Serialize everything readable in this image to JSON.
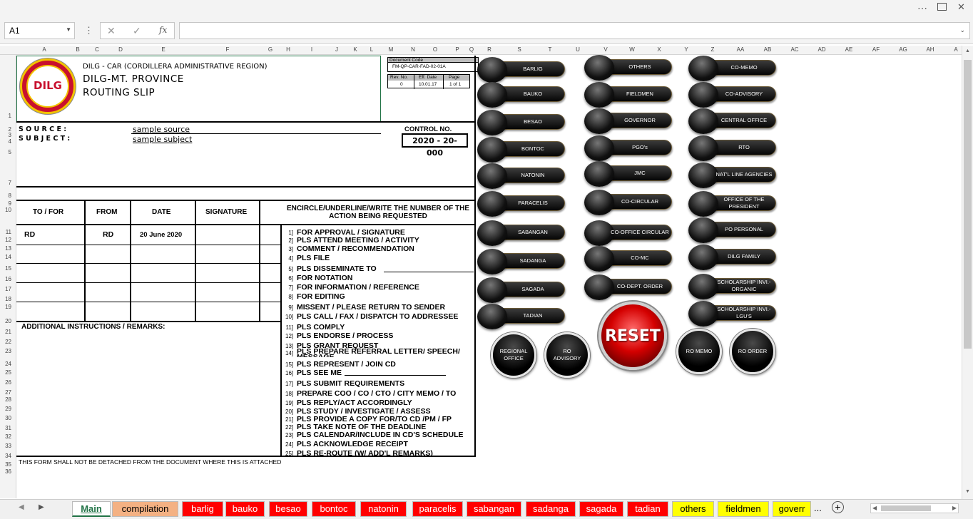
{
  "namebox": {
    "cell": "A1"
  },
  "columns": [
    "A",
    "B",
    "C",
    "D",
    "E",
    "F",
    "G",
    "H",
    "I",
    "J",
    "K",
    "L",
    "M",
    "N",
    "O",
    "P",
    "Q",
    "R",
    "S",
    "T",
    "U",
    "V",
    "W",
    "X",
    "Y",
    "Z",
    "AA",
    "AB",
    "AC",
    "AD",
    "AE",
    "AF",
    "AG",
    "AH",
    "A"
  ],
  "rows": [
    "1",
    "2",
    "3",
    "4",
    "5",
    "7",
    "8",
    "9",
    "10",
    "11",
    "12",
    "13",
    "14",
    "15",
    "16",
    "17",
    "18",
    "19",
    "20",
    "21",
    "22",
    "23",
    "24",
    "25",
    "26",
    "27",
    "28",
    "29",
    "30",
    "31",
    "32",
    "33",
    "34",
    "35",
    "36"
  ],
  "header": {
    "region": "DILG - CAR (CORDILLERA ADMINISTRATIVE REGION)",
    "office": "DILG-MT. PROVINCE",
    "title": "ROUTING SLIP",
    "logo_text": "DILG"
  },
  "doc_code": {
    "label": "Document Code",
    "code": "FM-QP-CAR-FAD-02-01A",
    "rev_label": "Rev. No.",
    "eff_label": "Eff. Date",
    "page_label": "Page",
    "rev": "0",
    "eff": "10.01.17",
    "page": "1 of 1"
  },
  "form": {
    "source_label": "S O U R C E :",
    "subject_label": "S U B J E C T :",
    "source": "sample source",
    "subject": "sample subject",
    "control_label": "CONTROL NO.",
    "control": "2020 - 20- 000",
    "col_to": "TO / FOR",
    "col_from": "FROM",
    "col_date": "DATE",
    "col_sig": "SIGNATURE",
    "col_action": "ENCIRCLE/UNDERLINE/WRITE THE NUMBER OF THE ACTION BEING REQUESTED",
    "row1_to": "RD",
    "row1_from": "RD",
    "row1_date": "20 June 2020",
    "remarks_label": "ADDITIONAL INSTRUCTIONS / REMARKS:",
    "footer": "THIS FORM SHALL NOT BE DETACHED FROM THE DOCUMENT WHERE THIS IS ATTACHED"
  },
  "actions": [
    {
      "n": "1]",
      "t": "FOR APPROVAL / SIGNATURE"
    },
    {
      "n": "2]",
      "t": "PLS ATTEND MEETING / ACTIVITY"
    },
    {
      "n": "3]",
      "t": "COMMENT / RECOMMENDATION"
    },
    {
      "n": "4]",
      "t": "PLS FILE"
    },
    {
      "n": "5]",
      "t": "PLS  DISSEMINATE TO"
    },
    {
      "n": "6]",
      "t": "FOR NOTATION"
    },
    {
      "n": "7]",
      "t": "FOR INFORMATION / REFERENCE"
    },
    {
      "n": "8]",
      "t": "FOR EDITING"
    },
    {
      "n": "9]",
      "t": "MISSENT / PLEASE RETURN TO SENDER"
    },
    {
      "n": "10]",
      "t": "PLS CALL / FAX / DISPATCH TO ADDRESSEE"
    },
    {
      "n": "11]",
      "t": "PLS COMPLY"
    },
    {
      "n": "12]",
      "t": "PLS ENDORSE / PROCESS"
    },
    {
      "n": "13]",
      "t": "PLS GRANT REQUEST"
    },
    {
      "n": "14]",
      "t": "PLS PREPARE REFERRAL LETTER/ SPEECH/ MESSAGE"
    },
    {
      "n": "15]",
      "t": "PLS REPRESENT / JOIN CD"
    },
    {
      "n": "16]",
      "t": "PLS SEE ME"
    },
    {
      "n": "17]",
      "t": "PLS SUBMIT REQUIREMENTS"
    },
    {
      "n": "18]",
      "t": "PREPARE COO / CO / CTO / CITY MEMO / TO"
    },
    {
      "n": "19]",
      "t": "PLS REPLY/ACT ACCORDINGLY"
    },
    {
      "n": "20]",
      "t": "PLS  STUDY / INVESTIGATE / ASSESS"
    },
    {
      "n": "21]",
      "t": "PLS  PROVIDE A COPY FOR/TO CD /PM / FP"
    },
    {
      "n": "22]",
      "t": "PLS TAKE NOTE OF THE DEADLINE"
    },
    {
      "n": "23]",
      "t": "PLS CALENDAR/INCLUDE IN CD'S SCHEDULE"
    },
    {
      "n": "24]",
      "t": "PLS ACKNOWLEDGE RECEIPT"
    },
    {
      "n": "25]",
      "t": "PLS  RE-ROUTE (W/ ADD'L REMARKS)"
    }
  ],
  "buttons_col1": [
    "BARLIG",
    "BAUKO",
    "BESAO",
    "BONTOC",
    "NATONIN",
    "PARACELIS",
    "SABANGAN",
    "SADANGA",
    "SAGADA",
    "TADIAN"
  ],
  "buttons_col2": [
    "OTHERS",
    "FIELDMEN",
    "GOVERNOR",
    "PGO's",
    "JMC",
    "CO-CIRCULAR",
    "CO-OFFICE CIRCULAR",
    "CO-MC",
    "CO-DEPT. ORDER"
  ],
  "buttons_col3": [
    "CO-MEMO",
    "CO-ADVISORY",
    "CENTRAL OFFICE",
    "RTO",
    "NAT'L LINE AGENCIES",
    "OFFICE OF THE PRESIDENT",
    "PO PERSONAL",
    "DILG FAMILY",
    "SCHOLARSHIP INVI.-ORGANIC",
    "SCHOLARSHIP INVI.-LGU'S"
  ],
  "round_buttons": [
    "REGIONAL OFFICE",
    "RO ADVISORY",
    "RO MEMO",
    "RO ORDER"
  ],
  "reset_label": "RESET",
  "tabs": [
    {
      "label": "Main",
      "color": "#ffffff",
      "text": "#217346"
    },
    {
      "label": "compilation",
      "color": "#f4b183",
      "text": "#000000"
    },
    {
      "label": "barlig",
      "color": "#ff0000",
      "text": "#ffffff"
    },
    {
      "label": "bauko",
      "color": "#ff0000",
      "text": "#ffffff"
    },
    {
      "label": "besao",
      "color": "#ff0000",
      "text": "#ffffff"
    },
    {
      "label": "bontoc",
      "color": "#ff0000",
      "text": "#ffffff"
    },
    {
      "label": "natonin",
      "color": "#ff0000",
      "text": "#ffffff"
    },
    {
      "label": "paracelis",
      "color": "#ff0000",
      "text": "#ffffff"
    },
    {
      "label": "sabangan",
      "color": "#ff0000",
      "text": "#ffffff"
    },
    {
      "label": "sadanga",
      "color": "#ff0000",
      "text": "#ffffff"
    },
    {
      "label": "sagada",
      "color": "#ff0000",
      "text": "#ffffff"
    },
    {
      "label": "tadian",
      "color": "#ff0000",
      "text": "#ffffff"
    },
    {
      "label": "others",
      "color": "#ffff00",
      "text": "#000000"
    },
    {
      "label": "fieldmen",
      "color": "#ffff00",
      "text": "#000000"
    },
    {
      "label": "goverr",
      "color": "#ffff00",
      "text": "#000000"
    }
  ],
  "tabs_more": "...",
  "accent": "#217346"
}
